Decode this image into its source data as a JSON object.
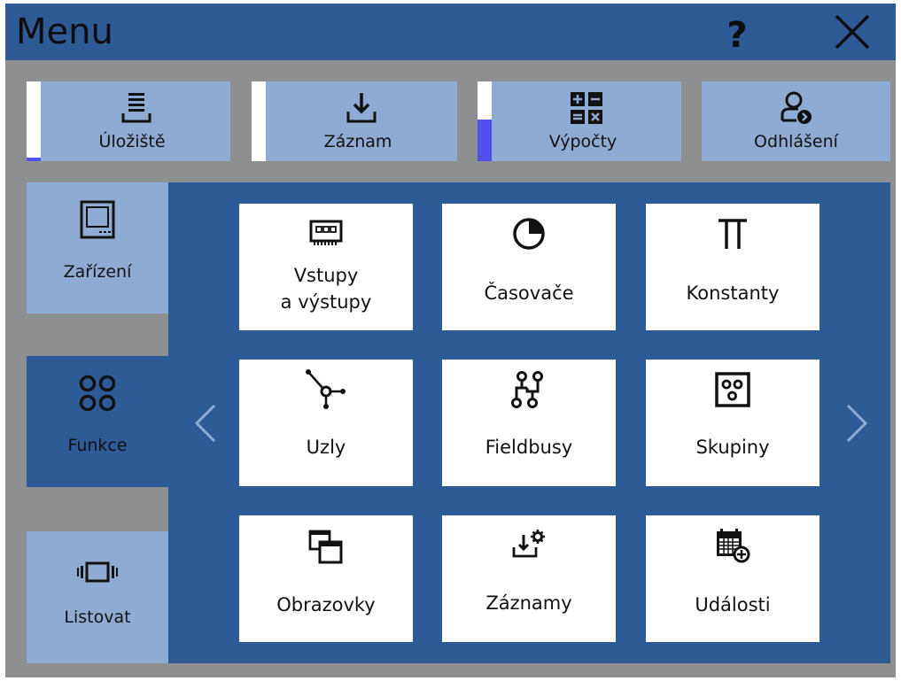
{
  "header": {
    "title": "Menu",
    "help_glyph": "?",
    "help_icon": "help-icon",
    "close_icon": "close-icon"
  },
  "top_bar": [
    {
      "label": "Úložiště",
      "icon": "storage-icon",
      "gauge_fill": 0.05
    },
    {
      "label": "Záznam",
      "icon": "download-icon",
      "gauge_fill": 0.0
    },
    {
      "label": "Výpočty",
      "icon": "calculator-icon",
      "gauge_fill": 0.52
    },
    {
      "label": "Odhlášení",
      "icon": "logout-user-icon"
    }
  ],
  "sidebar": [
    {
      "label": "Zařízení",
      "icon": "device-icon",
      "active": false
    },
    {
      "label": "Funkce",
      "icon": "functions-icon",
      "active": true
    },
    {
      "label": "Listovat",
      "icon": "browse-icon",
      "active": false
    }
  ],
  "grid": [
    {
      "label": "Vstupy\na výstupy",
      "icon": "io-module-icon"
    },
    {
      "label": "Časovače",
      "icon": "timer-icon"
    },
    {
      "label": "Konstanty",
      "icon": "pi-icon"
    },
    {
      "label": "Uzly",
      "icon": "node-icon"
    },
    {
      "label": "Fieldbusy",
      "icon": "fieldbus-icon"
    },
    {
      "label": "Skupiny",
      "icon": "group-icon"
    },
    {
      "label": "Obrazovky",
      "icon": "screens-icon"
    },
    {
      "label": "Záznamy",
      "icon": "record-settings-icon"
    },
    {
      "label": "Události",
      "icon": "calendar-add-icon"
    }
  ],
  "navigation": {
    "prev_icon": "chevron-left-icon",
    "next_icon": "chevron-right-icon"
  },
  "colors": {
    "header_bg": "#2e5a96",
    "tile_bg": "#8eabd4",
    "active_bg": "#2e5a96",
    "background": "#8d8f91",
    "gauge_fill": "#5050ee"
  }
}
